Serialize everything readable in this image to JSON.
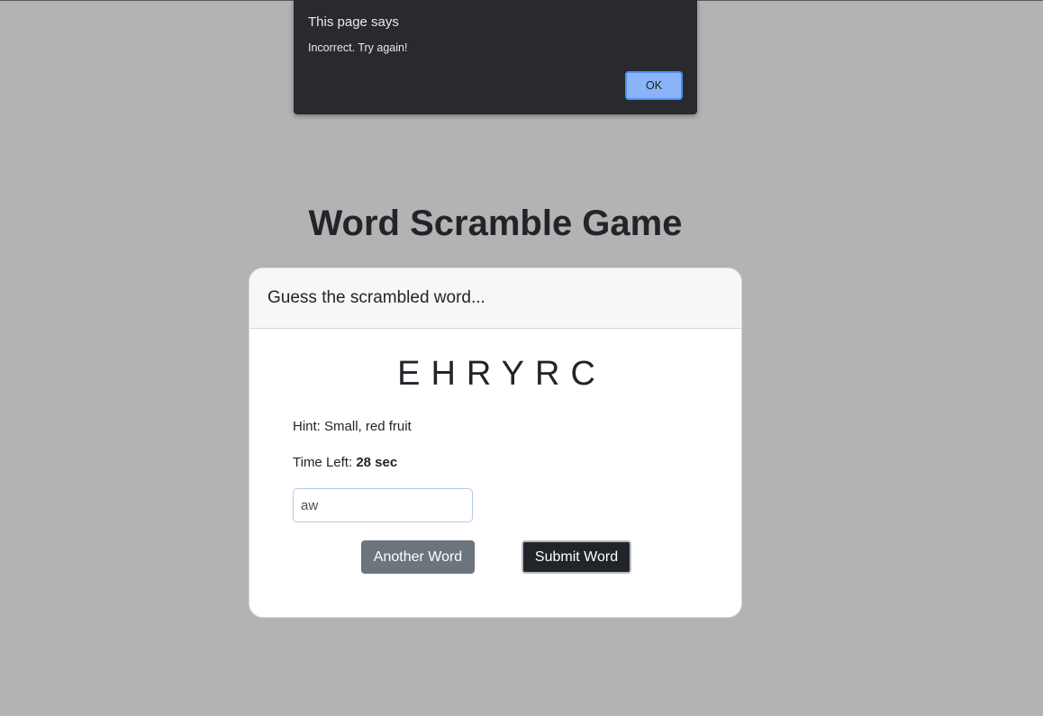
{
  "alert": {
    "title": "This page says",
    "message": "Incorrect. Try again!",
    "ok_label": "OK"
  },
  "page": {
    "title": "Word Scramble Game"
  },
  "card": {
    "header": "Guess the scrambled word...",
    "scrambled": "EHRYRC",
    "hint_label": "Hint:",
    "hint": "Small, red fruit",
    "time_label": "Time Left:",
    "time_value": "28 sec",
    "input_value": "aw",
    "another_label": "Another Word",
    "submit_label": "Submit Word"
  }
}
